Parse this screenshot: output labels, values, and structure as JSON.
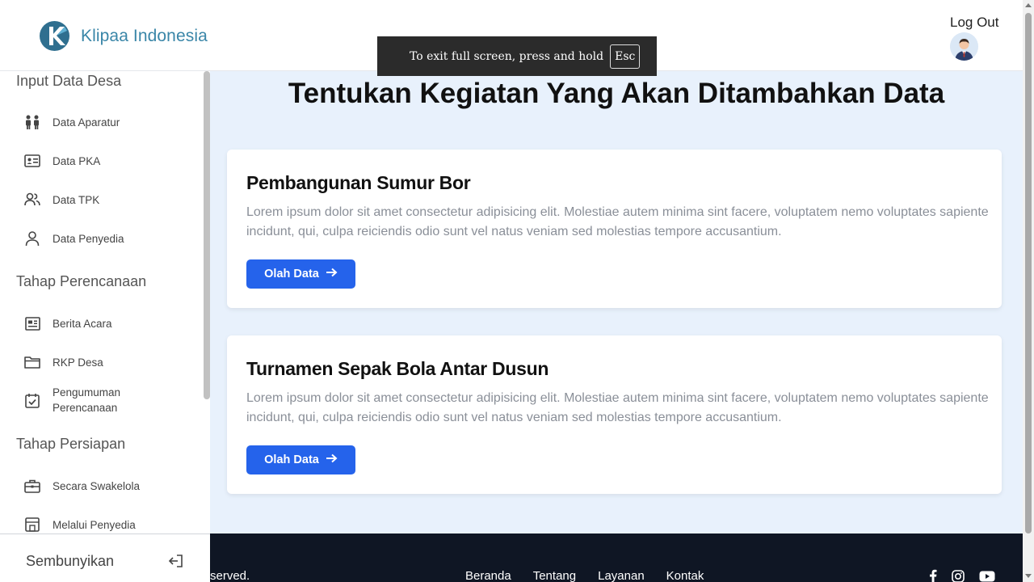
{
  "header": {
    "brand_name": "Klipaa Indonesia",
    "logout_label": "Log Out"
  },
  "fullscreen_toast": {
    "message": "To exit full screen, press and hold",
    "key": "Esc"
  },
  "sidebar": {
    "groups": [
      {
        "title": "Input Data Desa",
        "items": [
          {
            "label": "Data Aparatur",
            "icon": "people-icon"
          },
          {
            "label": "Data PKA",
            "icon": "id-card-icon"
          },
          {
            "label": "Data TPK",
            "icon": "users-icon"
          },
          {
            "label": "Data Penyedia",
            "icon": "user-icon"
          }
        ]
      },
      {
        "title": "Tahap Perencanaan",
        "items": [
          {
            "label": "Berita Acara",
            "icon": "newspaper-icon"
          },
          {
            "label": "RKP Desa",
            "icon": "folder-icon"
          },
          {
            "label": "Pengumuman Perencanaan",
            "icon": "calendar-check-icon"
          }
        ]
      },
      {
        "title": "Tahap Persiapan",
        "items": [
          {
            "label": "Secara Swakelola",
            "icon": "briefcase-icon"
          },
          {
            "label": "Melalui Penyedia",
            "icon": "store-icon"
          }
        ]
      }
    ],
    "hide_label": "Sembunyikan"
  },
  "main": {
    "title": "Tentukan Kegiatan Yang Akan Ditambahkan Data",
    "cards": [
      {
        "title": "Pembangunan Sumur Bor",
        "description": "Lorem ipsum dolor sit amet consectetur adipisicing elit. Molestiae autem minima sint facere, voluptatem nemo voluptates sapiente incidunt, qui, culpa reiciendis odio sunt vel natus veniam sed molestias tempore accusantium.",
        "button_label": "Olah Data"
      },
      {
        "title": "Turnamen Sepak Bola Antar Dusun",
        "description": "Lorem ipsum dolor sit amet consectetur adipisicing elit. Molestiae autem minima sint facere, voluptatem nemo voluptates sapiente incidunt, qui, culpa reiciendis odio sunt vel natus veniam sed molestias tempore accusantium.",
        "button_label": "Olah Data"
      }
    ]
  },
  "footer": {
    "copyright": "served.",
    "links": [
      "Beranda",
      "Tentang",
      "Layanan",
      "Kontak"
    ],
    "social": [
      "facebook-icon",
      "instagram-icon",
      "youtube-icon"
    ]
  },
  "colors": {
    "brand": "#3a86a8",
    "primary_button": "#2563eb",
    "page_background": "#e8f1fc",
    "footer_background": "#0f1624"
  }
}
